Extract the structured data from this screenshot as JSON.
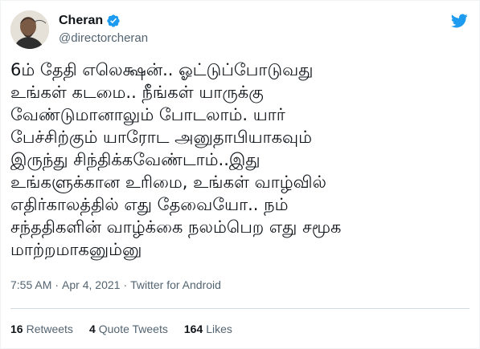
{
  "author": {
    "display_name": "Cheran",
    "handle": "@directorcheran",
    "verified": true,
    "avatar_icon": "profile-photo",
    "verified_icon": "verified-badge-icon",
    "brand_icon": "twitter-bird-icon"
  },
  "tweet": {
    "text": "6ம் தேதி எலெக்ஷன்.. ஓட்டுப்போடுவது\nஉங்கள் கடமை.. நீங்கள் யாருக்கு\nவேண்டுமானாலும் போடலாம். யார்\nபேச்சிற்கும் யாரோட அனுதாபியாகவும்\nஇருந்து சிந்திக்கவேண்டாம்..இது\nஉங்களுக்கான உரிமை, உங்கள் வாழ்வில்\nஎதிர்காலத்தில் எது தேவையோ.. நம்\nசந்ததிகளின் வாழ்க்கை நலம்பெற எது சமூக\nமாற்றமாகனும்னு",
    "time": "7:55 AM",
    "separator": "·",
    "date": "Apr 4, 2021",
    "source": "Twitter for Android"
  },
  "stats": {
    "retweets_count": "16",
    "retweets_label": "Retweets",
    "quotes_count": "4",
    "quotes_label": "Quote Tweets",
    "likes_count": "164",
    "likes_label": "Likes"
  },
  "colors": {
    "text_primary": "#0f1419",
    "text_secondary": "#536471",
    "verified_blue": "#1d9bf0",
    "divider": "#cfd9de"
  }
}
